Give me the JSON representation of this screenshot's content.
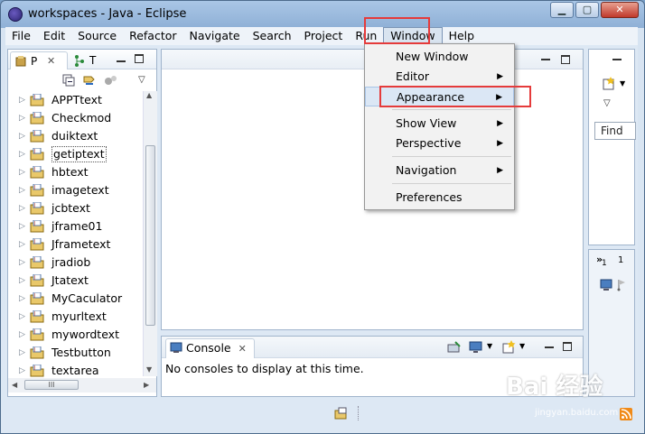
{
  "window": {
    "title": "workspaces - Java - Eclipse"
  },
  "menubar": [
    "File",
    "Edit",
    "Source",
    "Refactor",
    "Navigate",
    "Search",
    "Project",
    "Run",
    "Window",
    "Help"
  ],
  "left_panel": {
    "tabs": [
      "P",
      "T"
    ],
    "projects": [
      "APPTtext",
      "Checkmod",
      "duiktext",
      "getiptext",
      "hbtext",
      "imagetext",
      "jcbtext",
      "jframe01",
      "Jframetext",
      "jradiob",
      "Jtatext",
      "MyCaculator",
      "myurltext",
      "mywordtext",
      "Testbutton",
      "textarea"
    ],
    "selected_index": 3,
    "hscroll_label": "III"
  },
  "console": {
    "tab_label": "Console",
    "message": "No consoles to display at this time."
  },
  "right_panel": {
    "find_label": "Find",
    "tab_numbers": [
      "»",
      "1",
      "1"
    ]
  },
  "window_menu": {
    "items": [
      {
        "label": "New Window",
        "submenu": false
      },
      {
        "label": "Editor",
        "submenu": true
      },
      {
        "label": "Appearance",
        "submenu": true
      },
      {
        "label": "Show View",
        "submenu": true
      },
      {
        "label": "Perspective",
        "submenu": true
      },
      {
        "label": "Navigation",
        "submenu": true
      },
      {
        "label": "Preferences",
        "submenu": false
      }
    ],
    "highlighted": "Appearance"
  },
  "watermark": {
    "text": "Bai 经验",
    "url": "jingyan.baidu.com"
  },
  "colors": {
    "highlight_box": "#e53b3b",
    "menu_hover": "#dbe7f5",
    "window_chrome": "#dde8f4"
  }
}
